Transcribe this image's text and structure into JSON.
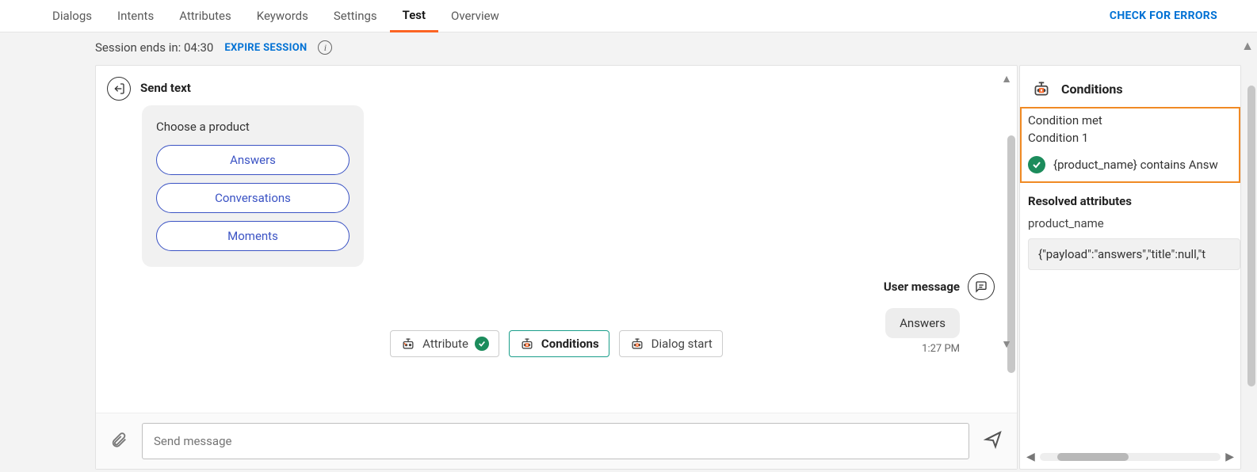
{
  "tabs": {
    "items": [
      "Dialogs",
      "Intents",
      "Attributes",
      "Keywords",
      "Settings",
      "Test",
      "Overview"
    ],
    "active_index": 5
  },
  "check_errors": "CHECK FOR ERRORS",
  "session": {
    "label": "Session ends in: 04:30",
    "expire": "EXPIRE SESSION"
  },
  "send_text": {
    "title": "Send text",
    "prompt": "Choose a product",
    "options": [
      "Answers",
      "Conversations",
      "Moments"
    ]
  },
  "user_message": {
    "label": "User message",
    "bubble": "Answers",
    "time": "1:27 PM"
  },
  "chips": {
    "attribute": "Attribute",
    "conditions": "Conditions",
    "dialog_start": "Dialog start"
  },
  "composer": {
    "placeholder": "Send message"
  },
  "side": {
    "title": "Conditions",
    "condition_met": "Condition met",
    "condition_num": "Condition 1",
    "rule": "{product_name} contains Answ",
    "resolved_title": "Resolved attributes",
    "attr_name": "product_name",
    "attr_value": "{\"payload\":\"answers\",\"title\":null,\"t"
  }
}
